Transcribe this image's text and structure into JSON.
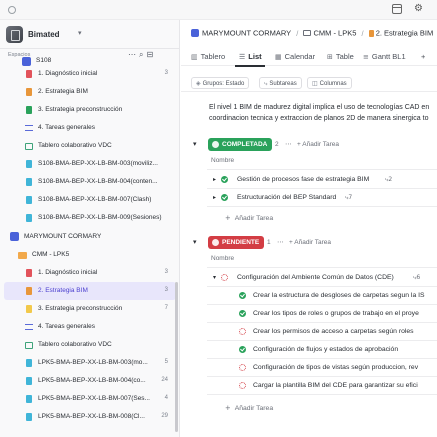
{
  "workspace": {
    "name": "Bimated"
  },
  "sidebar": {
    "spaces_label": "Espacios",
    "items": [
      {
        "label": "S108",
        "count": ""
      },
      {
        "label": "1. Diagnóstico inicial",
        "count": "3"
      },
      {
        "label": "2. Estrategia BIM",
        "count": ""
      },
      {
        "label": "3. Estrategia preconstrucción",
        "count": ""
      },
      {
        "label": "4. Tareas generales",
        "count": ""
      },
      {
        "label": "Tablero colaborativo VDC",
        "count": ""
      },
      {
        "label": "S108-BMA-BEP-XX-LB-BM-003(moviliz...",
        "count": ""
      },
      {
        "label": "S108-BMA-BEP-XX-LB-BM-004(conten...",
        "count": ""
      },
      {
        "label": "S108-BMA-BEP-XX-LB-BM-007(Clash)",
        "count": ""
      },
      {
        "label": "S108-BMA-BEP-XX-LB-BM-009(Sesiones)",
        "count": ""
      },
      {
        "label": "MARYMOUNT CORMARY",
        "count": ""
      },
      {
        "label": "CMM - LPK5",
        "count": ""
      },
      {
        "label": "1. Diagnóstico inicial",
        "count": "3"
      },
      {
        "label": "2. Estrategia BIM",
        "count": "3"
      },
      {
        "label": "3. Estrategia preconstrucción",
        "count": "7"
      },
      {
        "label": "4. Tareas generales",
        "count": ""
      },
      {
        "label": "Tablero colaborativo VDC",
        "count": ""
      },
      {
        "label": "LPK5-BMA-BEP-XX-LB-BM-003(mo...",
        "count": "5"
      },
      {
        "label": "LPK5-BMA-BEP-XX-LB-BM-004(co...",
        "count": "24"
      },
      {
        "label": "LPK5-BMA-BEP-XX-LB-BM-007(Ses...",
        "count": "4"
      },
      {
        "label": "LPK5-BMA-BEP-XX-LB-BM-008(Cl...",
        "count": "29"
      }
    ]
  },
  "breadcrumb": {
    "space": "MARYMOUNT CORMARY",
    "folder": "CMM - LPK5",
    "list": "2. Estrategia BIM"
  },
  "tabs": [
    {
      "label": "Tablero",
      "icon": "board-icon"
    },
    {
      "label": "List",
      "icon": "list-icon"
    },
    {
      "label": "Calendar",
      "icon": "calendar-icon"
    },
    {
      "label": "Table",
      "icon": "table-icon"
    },
    {
      "label": "Gantt BL1",
      "icon": "gantt-icon"
    },
    {
      "label": "+",
      "icon": "plus-icon"
    }
  ],
  "toolbar": {
    "group_by": "Grupos: Estado",
    "subtasks": "Subtareas",
    "columns": "Columnas"
  },
  "description": {
    "line1": "El nivel 1 BIM de madurez digital implica el uso de tecnologías CAD en",
    "line2": "coordinacion tecnica y extraccion de planos 2D de manera sinergica to"
  },
  "groups": {
    "completed": {
      "label": "COMPLETADA",
      "count": "2",
      "add": "Añadir Tarea",
      "column": "Nombre",
      "tasks": [
        {
          "name": "Gestión de procesos fase de estrategia BIM",
          "subtasks": "2"
        },
        {
          "name": "Estructuración del BEP Standard",
          "subtasks": "7"
        }
      ],
      "add_task": "Añadir Tarea"
    },
    "pending": {
      "label": "PENDIENTE",
      "count": "1",
      "add": "Añadir Tarea",
      "column": "Nombre",
      "parent": {
        "name": "Configuración del Ambiente Común de Datos (CDE)",
        "subtasks": "6"
      },
      "subtasks": [
        {
          "name": "Crear la estructura de desgloses de carpetas segun la IS",
          "status": "done"
        },
        {
          "name": "Crear los tipos de roles o grupos de trabajo en el proye",
          "status": "done"
        },
        {
          "name": "Crear los permisos de acceso a carpetas según roles",
          "status": "pending"
        },
        {
          "name": "Configuración de flujos y estados de aprobación",
          "status": "done"
        },
        {
          "name": "Configuración de tipos de vistas según produccion, rev",
          "status": "pending"
        },
        {
          "name": "Cargar la plantilla BIM del CDE para garantizar su efici",
          "status": "pending"
        }
      ],
      "add_task": "Añadir Tarea"
    }
  },
  "colors": {
    "accent": "#4b3fcf",
    "completed": "#2aa25b",
    "pending": "#d33d44",
    "space": "#4a62d9",
    "folder": "#f2a94b"
  }
}
